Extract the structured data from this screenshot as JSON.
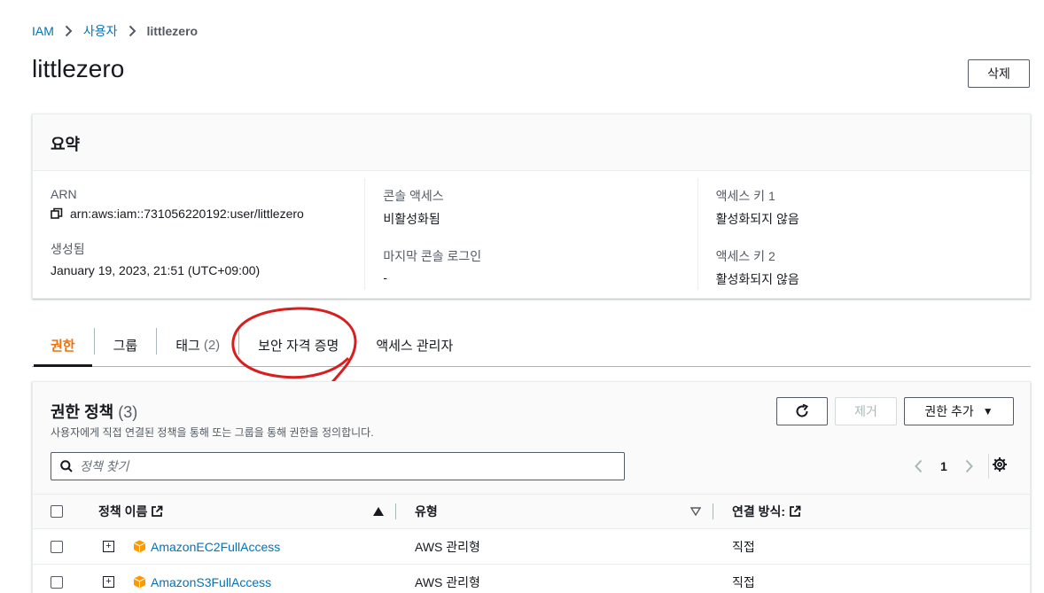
{
  "breadcrumb": {
    "root": "IAM",
    "users": "사용자",
    "current": "littlezero"
  },
  "page": {
    "title": "littlezero",
    "delete_label": "삭제"
  },
  "summary": {
    "title": "요약",
    "arn_label": "ARN",
    "arn_value": "arn:aws:iam::731056220192:user/littlezero",
    "created_label": "생성됨",
    "created_value": "January 19, 2023, 21:51 (UTC+09:00)",
    "console_access_label": "콘솔 액세스",
    "console_access_value": "비활성화됨",
    "last_login_label": "마지막 콘솔 로그인",
    "last_login_value": "-",
    "access_key1_label": "액세스 키 1",
    "access_key1_value": "활성화되지 않음",
    "access_key2_label": "액세스 키 2",
    "access_key2_value": "활성화되지 않음"
  },
  "tabs": [
    {
      "label": "권한",
      "count": ""
    },
    {
      "label": "그룹",
      "count": ""
    },
    {
      "label": "태그",
      "count": "(2)"
    },
    {
      "label": "보안 자격 증명",
      "count": ""
    },
    {
      "label": "액세스 관리자",
      "count": ""
    }
  ],
  "policies": {
    "title": "권한 정책",
    "count": "(3)",
    "description": "사용자에게 직접 연결된 정책을 통해 또는 그룹을 통해 권한을 정의합니다.",
    "remove_label": "제거",
    "add_label": "권한 추가",
    "search_placeholder": "정책 찾기",
    "page_number": "1",
    "columns": {
      "name": "정책 이름",
      "type": "유형",
      "attach": "연결 방식:"
    },
    "rows": [
      {
        "name": "AmazonEC2FullAccess",
        "type": "AWS 관리형",
        "attach": "직접"
      },
      {
        "name": "AmazonS3FullAccess",
        "type": "AWS 관리형",
        "attach": "직접"
      }
    ]
  },
  "colors": {
    "link": "#0073bb",
    "active_tab": "#ec7211",
    "annotation": "#d81e1e",
    "aws_orange": "#ff9900"
  }
}
